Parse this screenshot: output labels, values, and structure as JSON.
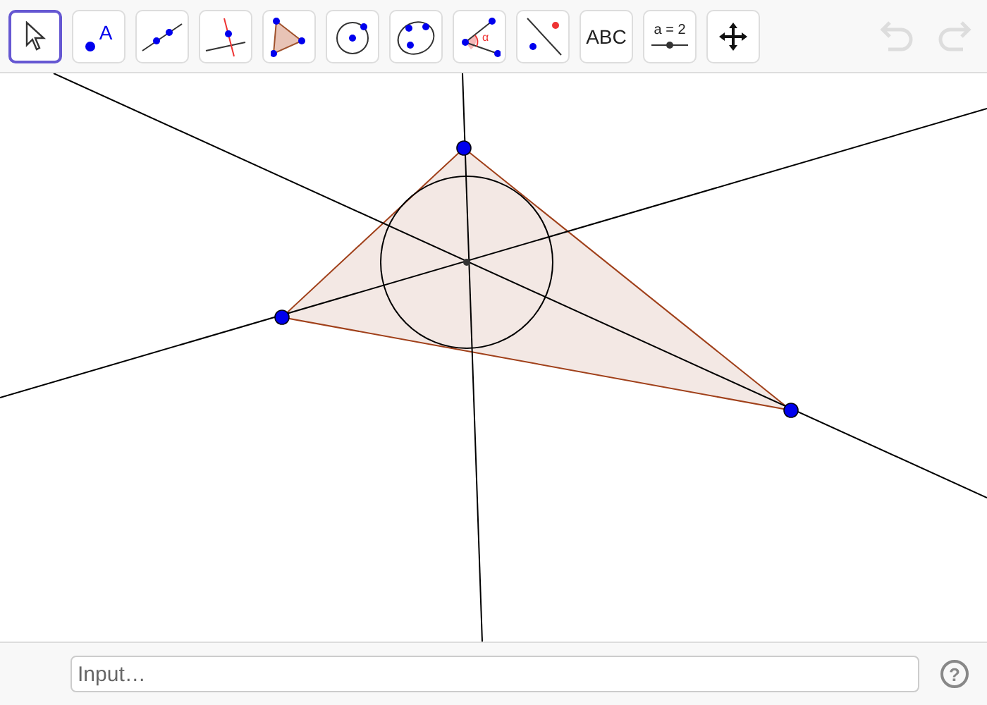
{
  "toolbar": {
    "tools": [
      {
        "kind": "move",
        "selected": true
      },
      {
        "kind": "point",
        "label": "A",
        "selected": false
      },
      {
        "kind": "line",
        "selected": false
      },
      {
        "kind": "perpendicular",
        "selected": false
      },
      {
        "kind": "polygon",
        "selected": false
      },
      {
        "kind": "circle",
        "selected": false
      },
      {
        "kind": "conic",
        "selected": false
      },
      {
        "kind": "angle",
        "label": "α",
        "selected": false
      },
      {
        "kind": "reflect",
        "selected": false
      },
      {
        "kind": "text",
        "label": "ABC",
        "selected": false
      },
      {
        "kind": "slider",
        "label": "a = 2",
        "selected": false
      },
      {
        "kind": "pan",
        "selected": false
      }
    ],
    "undo": {
      "disabled": true
    },
    "redo": {
      "disabled": true
    }
  },
  "input_bar": {
    "placeholder": "Input…",
    "help": "?"
  }
}
